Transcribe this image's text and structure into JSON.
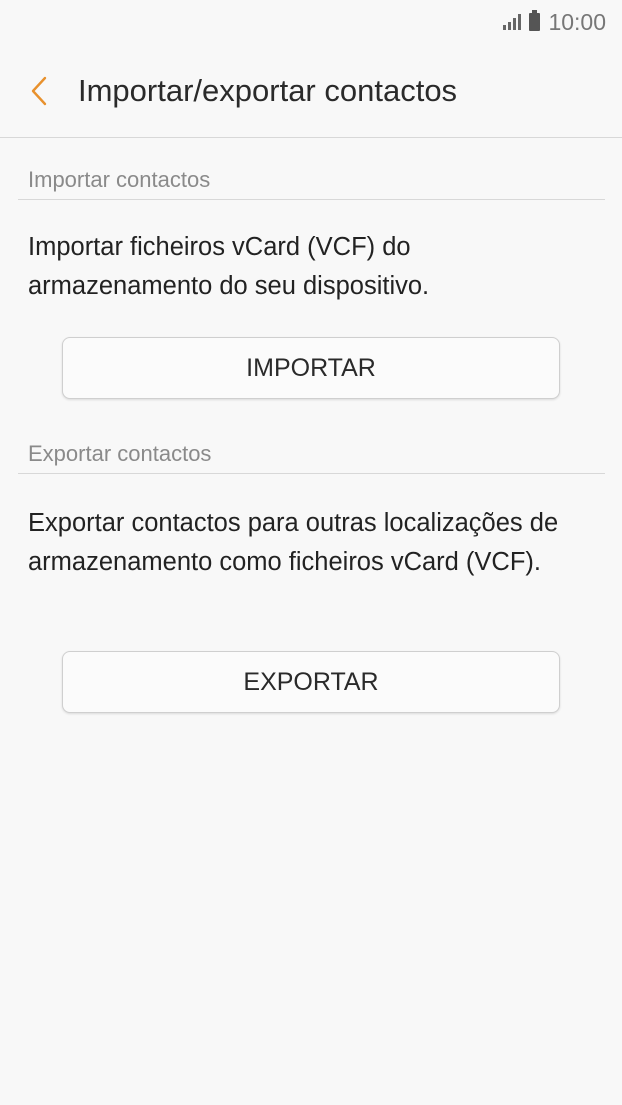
{
  "status_bar": {
    "time": "10:00",
    "signal_icon": "signal-icon",
    "battery_icon": "battery-icon"
  },
  "app_bar": {
    "back_icon": "chevron-left-icon",
    "title": "Importar/exportar contactos",
    "accent_color": "#e8912d"
  },
  "import_section": {
    "header": "Importar contactos",
    "description": "Importar ficheiros vCard (VCF) do armazenamento do seu dispositivo.",
    "button_label": "IMPORTAR"
  },
  "export_section": {
    "header": "Exportar contactos",
    "description": "Exportar contactos para outras localizações de armazenamento como ficheiros vCard (VCF).",
    "button_label": "EXPORTAR"
  }
}
